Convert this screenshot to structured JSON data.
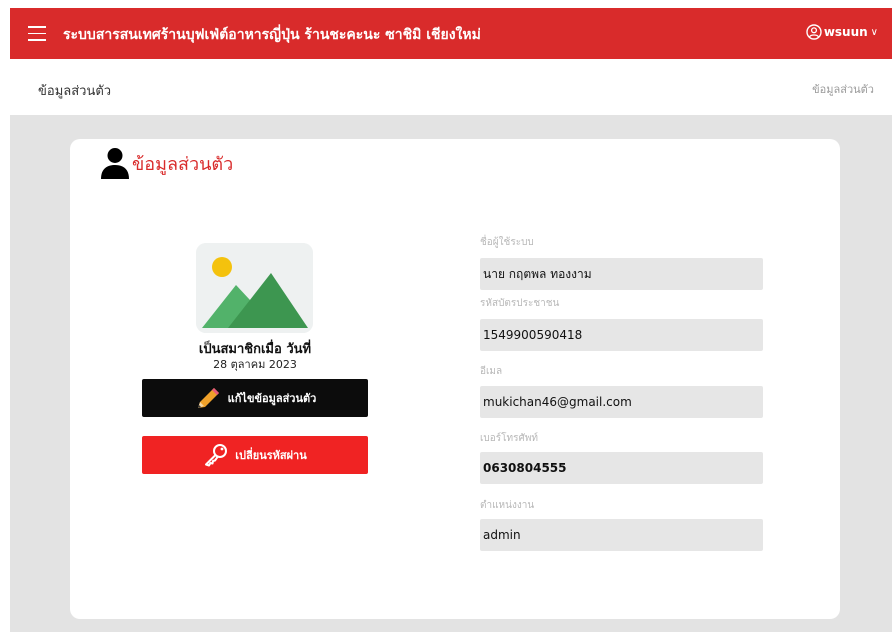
{
  "header": {
    "title": "ระบบสารสนเทศร้านบุฟเฟ่ต์อาหารญี่ปุ่น ร้านชะคะนะ ซาชิมิ เชียงใหม่",
    "user_name": "wsuun",
    "user_chevron": "∨",
    "menu_icon": "hamburger-icon",
    "user_icon": "user-circle-icon"
  },
  "subheader": {
    "page_title": "ข้อมูลส่วนตัว",
    "breadcrumb": "ข้อมูลส่วนตัว"
  },
  "profile": {
    "card_title": "ข้อมูลส่วนตัว",
    "avatar_icon": "image-placeholder-icon",
    "member_label": "เป็นสมาชิกเมื่อ วันที่",
    "member_date": "28 ตุลาคม 2023",
    "edit_button": "แก้ไขข้อมูลส่วนตัว",
    "change_password_button": "เปลี่ยนรหัสผ่าน",
    "fields": [
      {
        "label": "ชื่อผู้ใช้ระบบ",
        "value": "นาย กฤตพล ทองงาม"
      },
      {
        "label": "รหัสบัตรประชาชน",
        "value": "1549900590418"
      },
      {
        "label": "อีเมล",
        "value": "mukichan46@gmail.com"
      },
      {
        "label": "เบอร์โทรศัพท์",
        "value": "0630804555"
      },
      {
        "label": "ตำแหน่งงาน",
        "value": "admin"
      }
    ]
  },
  "colors": {
    "brand_red": "#d92b2b",
    "button_red": "#f02323",
    "button_black": "#0c0c0c",
    "page_bg": "#e3e3e3"
  }
}
